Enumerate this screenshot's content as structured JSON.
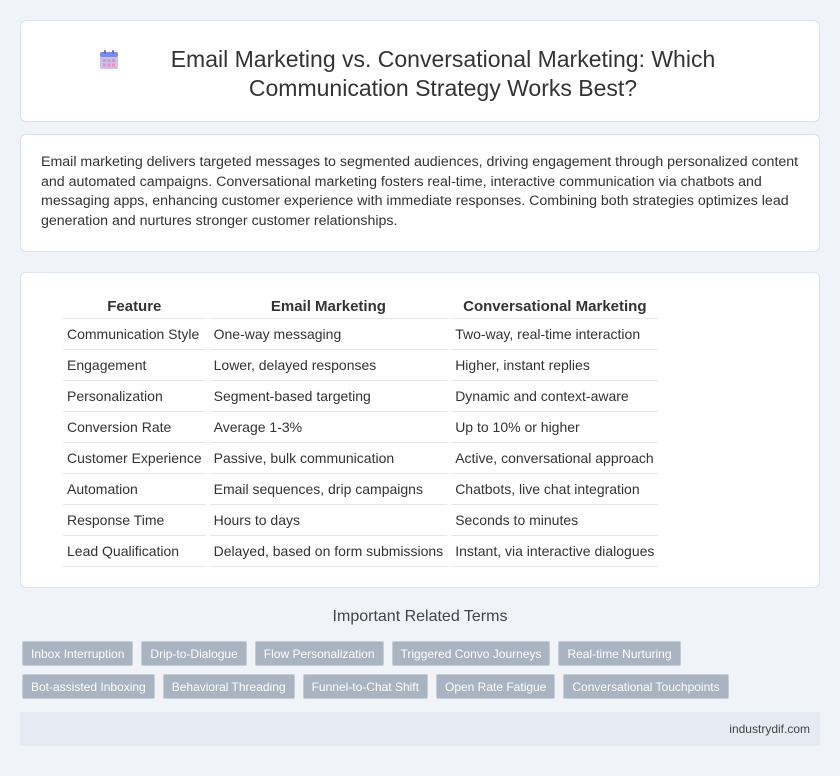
{
  "header": {
    "title": "Email Marketing vs. Conversational Marketing: Which Communication Strategy Works Best?",
    "icon": "calendar-icon"
  },
  "summary": {
    "text": "Email marketing delivers targeted messages to segmented audiences, driving engagement through personalized content and automated campaigns. Conversational marketing fosters real-time, interactive communication via chatbots and messaging apps, enhancing customer experience with immediate responses. Combining both strategies optimizes lead generation and nurtures stronger customer relationships."
  },
  "table": {
    "headers": [
      "Feature",
      "Email Marketing",
      "Conversational Marketing"
    ],
    "rows": [
      [
        "Communication Style",
        "One-way messaging",
        "Two-way, real-time interaction"
      ],
      [
        "Engagement",
        "Lower, delayed responses",
        "Higher, instant replies"
      ],
      [
        "Personalization",
        "Segment-based targeting",
        "Dynamic and context-aware"
      ],
      [
        "Conversion Rate",
        "Average 1-3%",
        "Up to 10% or higher"
      ],
      [
        "Customer Experience",
        "Passive, bulk communication",
        "Active, conversational approach"
      ],
      [
        "Automation",
        "Email sequences, drip campaigns",
        "Chatbots, live chat integration"
      ],
      [
        "Response Time",
        "Hours to days",
        "Seconds to minutes"
      ],
      [
        "Lead Qualification",
        "Delayed, based on form submissions",
        "Instant, via interactive dialogues"
      ]
    ]
  },
  "related": {
    "title": "Important Related Terms",
    "tags": [
      "Inbox Interruption",
      "Drip-to-Dialogue",
      "Flow Personalization",
      "Triggered Convo Journeys",
      "Real-time Nurturing",
      "Bot-assisted Inboxing",
      "Behavioral Threading",
      "Funnel-to-Chat Shift",
      "Open Rate Fatigue",
      "Conversational Touchpoints"
    ]
  },
  "footer": {
    "site": "industrydif.com"
  },
  "colors": {
    "background": "#f0f3f8",
    "tag": "#a9b3c2",
    "footer": "#e6ebf3"
  }
}
